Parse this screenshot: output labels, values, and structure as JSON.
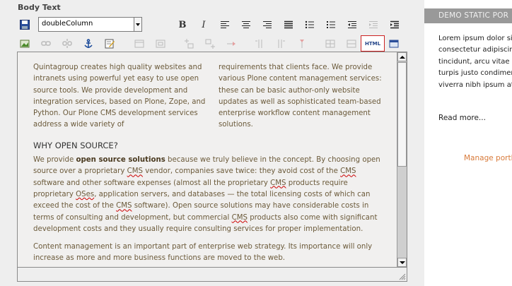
{
  "field_label": "Body Text",
  "toolbar": {
    "style_select": "doubleColumn",
    "bold": "B",
    "italic": "I",
    "html": "HTML",
    "row1_icons": [
      "save-icon",
      "bold-icon",
      "italic-icon",
      "align-left-icon",
      "align-center-icon",
      "align-right-icon",
      "align-justify-icon",
      "bullet-list-icon",
      "numbered-list-icon",
      "outdent-icon",
      "indent-icon"
    ],
    "row2_icons": [
      "insert-image-icon",
      "insert-link-icon",
      "unlink-icon",
      "anchor-icon",
      "edit-page-icon",
      "table-icon",
      "table-props-icon",
      "row-before-icon",
      "row-after-icon",
      "delete-row-icon",
      "col-before-icon",
      "col-after-icon",
      "delete-col-icon",
      "merge-cells-icon",
      "split-cells-icon",
      "html-source-icon",
      "fullscreen-icon"
    ]
  },
  "content": {
    "col1": "Quintagroup creates high quality websites and intranets using powerful yet easy to use open source tools. We provide development and integration services, based on Plone, Zope, and Python. Our Plone CMS development services address a wide variety of",
    "col2": "requirements that clients face. We provide various Plone content management services: these can be basic author-only website updates as well as sophisticated team-based enterprise workflow content management solutions.",
    "heading": "WHY OPEN SOURCE?",
    "p1_a": "We provide ",
    "p1_strong": "open source solutions",
    "p1_b": " because we truly believe in the concept. By choosing open source over a proprietary ",
    "cms": "CMS",
    "p1_c": " vendor, companies save twice: they avoid cost of the ",
    "p1_d": " software and other software expenses (almost all the proprietary ",
    "p1_e": " products require proprietary ",
    "oses": "OSes",
    "p1_f": ", application servers, and databases — the total licensing costs of which can exceed the cost of the ",
    "p1_g": " software). Open source solutions may have considerable costs in terms of consulting and development, but commercial ",
    "p1_h": " products also come with significant development costs and they usually require consulting services for proper implementation.",
    "p2": "Content management is an important part of enterprise web strategy. Its importance will only increase as more and more business functions are moved to the web."
  },
  "portlet": {
    "title": "DEMO STATIC POR",
    "lines": [
      "Lorem ipsum dolor sit",
      "consectetur adipiscing",
      "tincidunt, arcu vitae la",
      "turpis justo condiment",
      "viverra nibh ipsum at"
    ],
    "read_more": "Read more...",
    "manage": "Manage portle"
  },
  "colors": {
    "accent": "#d87a3a",
    "portlet_header": "#999999",
    "html_border": "#cc2222"
  }
}
